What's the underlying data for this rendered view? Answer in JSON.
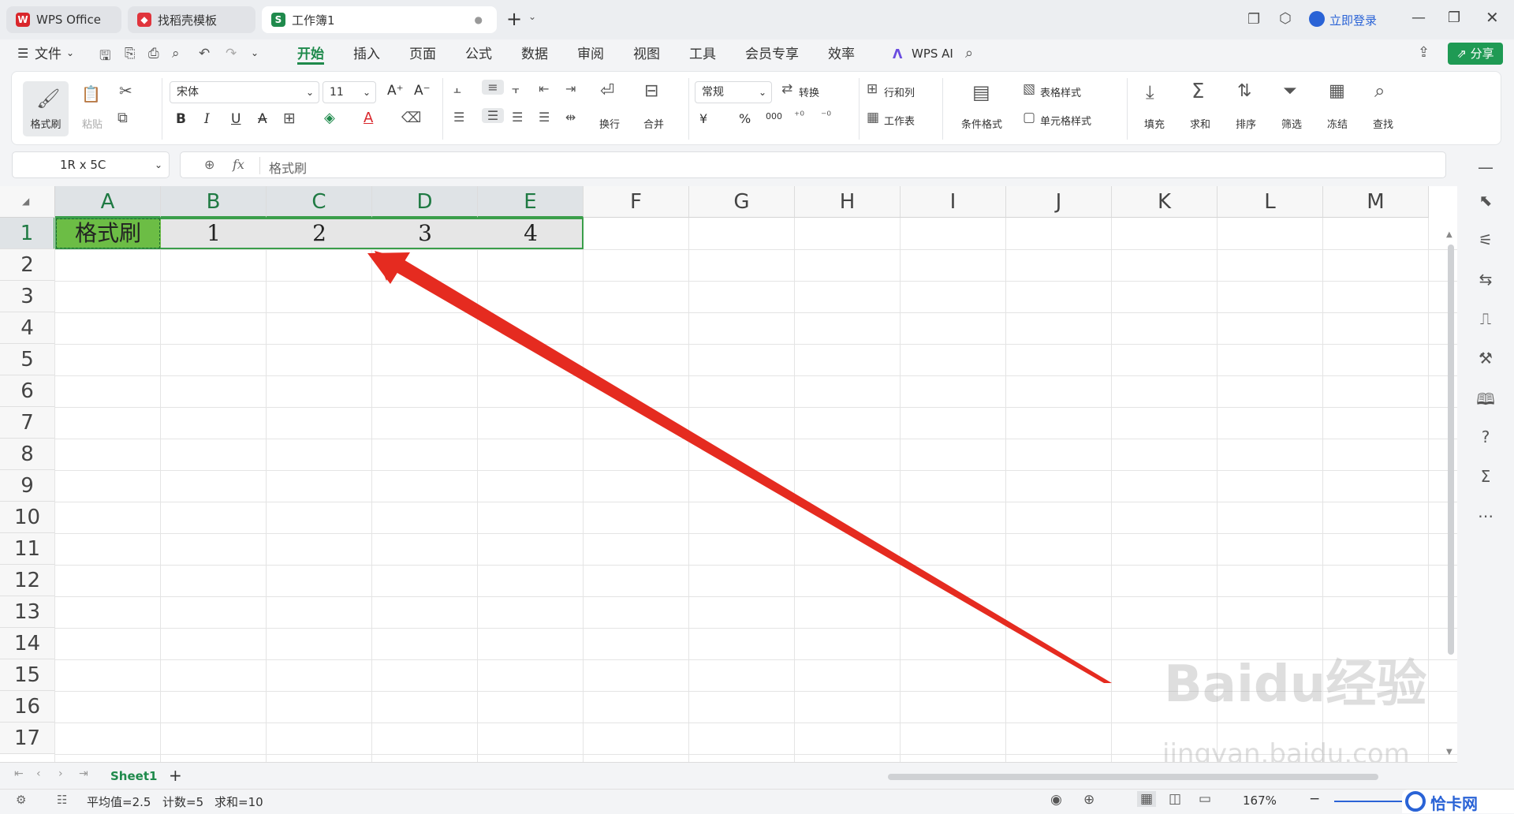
{
  "titlebar": {
    "tabs": [
      {
        "label": "WPS Office",
        "logo": "W",
        "color": "#d9262b"
      },
      {
        "label": "找稻壳模板",
        "logo": "◆",
        "color": "#e0343c"
      },
      {
        "label": "工作簿1",
        "logo": "S",
        "color": "#1f8a4c"
      }
    ],
    "new_tab": "+",
    "login": "立即登录"
  },
  "menubar": {
    "file": "文件",
    "items": [
      "开始",
      "插入",
      "页面",
      "公式",
      "数据",
      "审阅",
      "视图",
      "工具",
      "会员专享",
      "效率"
    ],
    "active": "开始",
    "wps_ai": "WPS AI",
    "share": "分享"
  },
  "ribbon": {
    "format_painter": "格式刷",
    "paste": "粘贴",
    "font": "宋体",
    "font_size": "11",
    "wrap": "换行",
    "merge": "合并",
    "number_format": "常规",
    "convert": "转换",
    "row_col": "行和列",
    "worksheet": "工作表",
    "cond_format": "条件格式",
    "table_style": "表格样式",
    "cell_style": "单元格样式",
    "fill": "填充",
    "sum": "求和",
    "sort": "排序",
    "filter": "筛选",
    "freeze": "冻结",
    "find": "查找",
    "bold": "B",
    "italic": "I",
    "underline": "U",
    "strike": "A",
    "currency": "¥",
    "percent": "%",
    "thousands": "000",
    "font_grow": "A⁺",
    "font_shrink": "A⁻"
  },
  "formula": {
    "namebox": "1R x 5C",
    "fx": "fx",
    "content": "格式刷"
  },
  "grid": {
    "columns": [
      "A",
      "B",
      "C",
      "D",
      "E",
      "F",
      "G",
      "H",
      "I",
      "J",
      "K",
      "L",
      "M"
    ],
    "rows": [
      "1",
      "2",
      "3",
      "4",
      "5",
      "6",
      "7",
      "8",
      "9",
      "10",
      "11",
      "12",
      "13",
      "14",
      "15",
      "16",
      "17"
    ],
    "row1": [
      "格式刷",
      "1",
      "2",
      "3",
      "4"
    ],
    "fill_color": "#6cbd45"
  },
  "sheets": {
    "active": "Sheet1",
    "add": "+"
  },
  "status": {
    "average": "平均值=2.5",
    "count": "计数=5",
    "sum": "求和=10",
    "zoom": "167%"
  },
  "watermark": {
    "brand": "Baidu经验",
    "url": "jingyan.baidu.com",
    "corner": "恰卡网"
  },
  "colors": {
    "accent": "#1f8a4c",
    "arrow": "#e52b20"
  }
}
